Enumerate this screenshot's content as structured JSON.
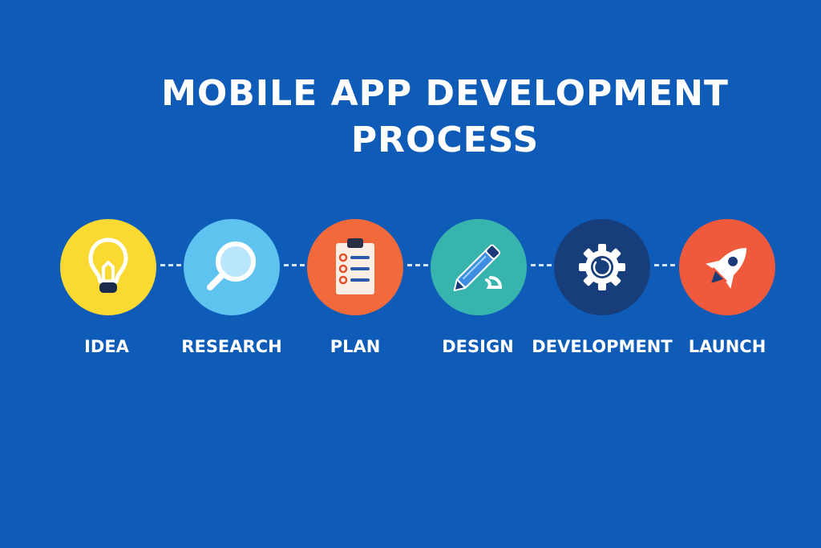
{
  "title": {
    "line1": "MOBILE APP DEVELOPMENT",
    "line2": "PROCESS"
  },
  "steps": [
    {
      "label": "IDEA",
      "icon": "lightbulb-icon",
      "color": "#fbd933"
    },
    {
      "label": "RESEARCH",
      "icon": "magnifier-icon",
      "color": "#5ec3ef"
    },
    {
      "label": "PLAN",
      "icon": "clipboard-checklist-icon",
      "color": "#f26a3b"
    },
    {
      "label": "DESIGN",
      "icon": "pen-icon",
      "color": "#38b4ae"
    },
    {
      "label": "DEVELOPMENT",
      "icon": "gear-icon",
      "color": "#173d7a"
    },
    {
      "label": "LAUNCH",
      "icon": "rocket-icon",
      "color": "#ef5a3c"
    }
  ],
  "colors": {
    "background": "#0f5cb8",
    "connector": "#d7e4f6"
  }
}
